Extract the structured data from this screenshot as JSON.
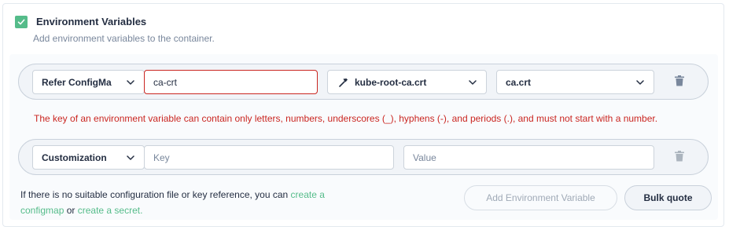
{
  "env": {
    "title": "Environment Variables",
    "subtitle": "Add environment variables to the container.",
    "enabled": true
  },
  "rows": [
    {
      "type": "Refer ConfigMa",
      "key": "ca-crt",
      "source_icon": "hammer-icon",
      "source": "kube-root-ca.crt",
      "source_key": "ca.crt"
    },
    {
      "type": "Customization",
      "key_placeholder": "Key",
      "value_placeholder": "Value"
    }
  ],
  "error_message": "The key of an environment variable can contain only letters, numbers, underscores (_), hyphens (-), and periods (.), and must not start with a number.",
  "footer": {
    "text_before": "If there is no suitable configuration file or key reference, you can ",
    "link_configmap": "create a configmap",
    "text_or": " or ",
    "link_secret": "create a secret."
  },
  "buttons": {
    "add": "Add Environment Variable",
    "bulk": "Bulk quote"
  },
  "colors": {
    "accent": "#55bc8a",
    "error": "#ca2621",
    "text": "#242e42",
    "muted": "#79879c"
  }
}
